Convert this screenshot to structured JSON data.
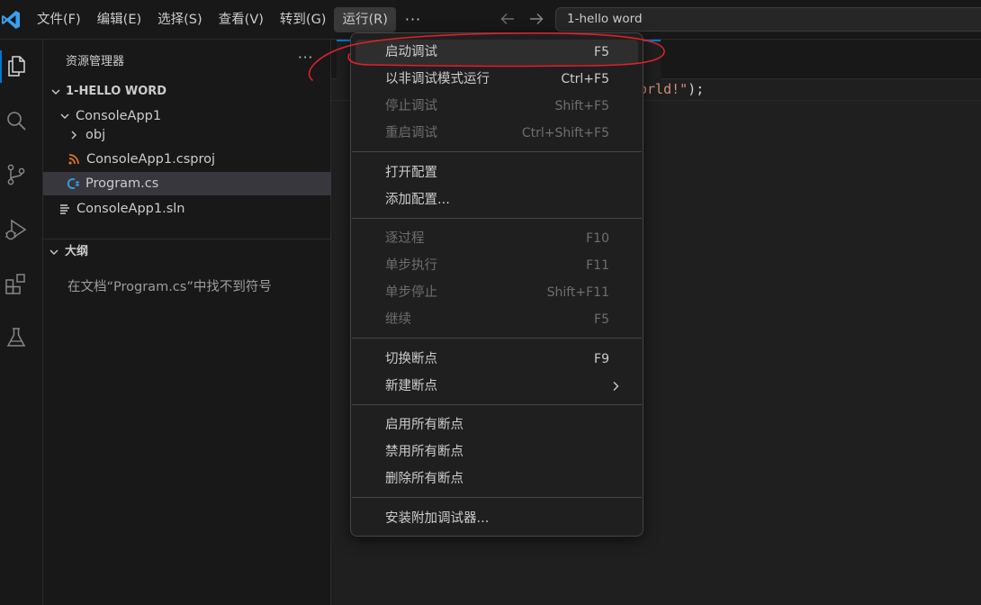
{
  "titlebar": {
    "menus": [
      {
        "label": "文件(F)"
      },
      {
        "label": "编辑(E)"
      },
      {
        "label": "选择(S)"
      },
      {
        "label": "查看(V)"
      },
      {
        "label": "转到(G)"
      },
      {
        "label": "运行(R)"
      }
    ],
    "more_label": "···",
    "command_center_text": "1-hello word"
  },
  "sidebar": {
    "title": "资源管理器",
    "more_label": "···",
    "workspace_header": "1-HELLO WORD",
    "tree": [
      {
        "label": "ConsoleApp1"
      },
      {
        "label": "obj"
      },
      {
        "label": "ConsoleApp1.csproj"
      },
      {
        "label": "Program.cs"
      },
      {
        "label": "ConsoleApp1.sln"
      }
    ],
    "outline_header": "大纲",
    "outline_empty": "在文档“Program.cs”中找不到符号"
  },
  "editor": {
    "code_visible_string": "orld!\"",
    "code_visible_punct": ");"
  },
  "run_menu": {
    "items": [
      {
        "label": "启动调试",
        "key": "F5"
      },
      {
        "label": "以非调试模式运行",
        "key": "Ctrl+F5"
      },
      {
        "label": "停止调试",
        "key": "Shift+F5"
      },
      {
        "label": "重启调试",
        "key": "Ctrl+Shift+F5"
      },
      {
        "label": "打开配置",
        "key": ""
      },
      {
        "label": "添加配置...",
        "key": ""
      },
      {
        "label": "逐过程",
        "key": "F10"
      },
      {
        "label": "单步执行",
        "key": "F11"
      },
      {
        "label": "单步停止",
        "key": "Shift+F11"
      },
      {
        "label": "继续",
        "key": "F5"
      },
      {
        "label": "切换断点",
        "key": "F9"
      },
      {
        "label": "新建断点",
        "key": ""
      },
      {
        "label": "启用所有断点",
        "key": ""
      },
      {
        "label": "禁用所有断点",
        "key": ""
      },
      {
        "label": "删除所有断点",
        "key": ""
      },
      {
        "label": "安装附加调试器...",
        "key": ""
      }
    ]
  },
  "colors": {
    "accent": "#0078d4",
    "annotation": "#e0202a",
    "csharp_icon": "#3a96dd",
    "rss_icon": "#e8731a"
  }
}
